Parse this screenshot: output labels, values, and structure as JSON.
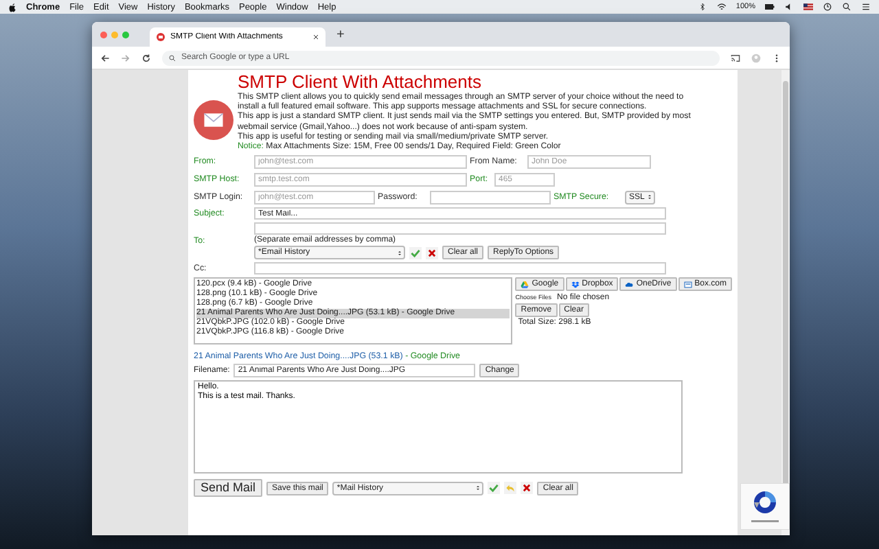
{
  "menubar": {
    "app": "Chrome",
    "menus": [
      "File",
      "Edit",
      "View",
      "History",
      "Bookmarks",
      "People",
      "Window",
      "Help"
    ],
    "battery": "100%"
  },
  "browser": {
    "tab_title": "SMTP Client With Attachments",
    "new_tab": "+",
    "omnibox_placeholder": "Search Google or type a URL"
  },
  "page": {
    "title": "SMTP Client With Attachments",
    "description": [
      "This SMTP client allows you to quickly send email messages through an SMTP server of your choice without the need to install a full featured email software. This app supports message attachments and SSL for secure connections.",
      "This app is just a standard SMTP client. It just sends mail via the SMTP settings you entered. But, SMTP provided by most webmail service (Gmail,Yahoo...) does not work because of anti-spam system.",
      "This app is useful for testing or sending mail via small/medium/private SMTP server."
    ],
    "notice_label": "Notice:",
    "notice": "Max Attachments Size: 15M, Free 00 sends/1 Day, Required Field: Green Color"
  },
  "settings": [
    [
      {
        "label": "From:",
        "required": true,
        "kind": "input",
        "placeholder": "john@test.com"
      },
      {
        "label": "From Name:",
        "required": false,
        "kind": "input",
        "placeholder": "John Doe"
      }
    ],
    [
      {
        "label": "SMTP Host:",
        "required": true,
        "kind": "input",
        "placeholder": "smtp.test.com"
      },
      {
        "label": "Port:",
        "required": true,
        "kind": "input",
        "placeholder": "465"
      }
    ],
    [
      {
        "label": "SMTP Login:",
        "required": false,
        "kind": "input",
        "placeholder": "john@test.com"
      },
      {
        "label": "Password:",
        "required": false,
        "kind": "input"
      },
      {
        "label": "SMTP Secure:",
        "required": true,
        "kind": "select",
        "value": "SSL"
      }
    ]
  ],
  "subject": {
    "label": "Subject:",
    "required": true,
    "value": "Test Mail..."
  },
  "to": {
    "label": "To:",
    "required": true,
    "hint": "(Separate email addresses by comma)",
    "history": "*Email History",
    "clear": "Clear all",
    "replyto": "ReplyTo Options"
  },
  "cc": {
    "label": "Cc:",
    "required": false
  },
  "attachments": {
    "files": [
      {
        "name": "120.pcx (9.4 kB) - Google Drive",
        "selected": false
      },
      {
        "name": "128.png (10.1 kB) - Google Drive",
        "selected": false
      },
      {
        "name": "128.png (6.7 kB) - Google Drive",
        "selected": false
      },
      {
        "name": "21 Animal Parents Who Are Just Doing....JPG (53.1 kB) - Google Drive",
        "selected": true
      },
      {
        "name": "21VQbkP.JPG (102.0 kB) - Google Drive",
        "selected": false
      },
      {
        "name": "21VQbkP.JPG (116.8 kB) - Google Drive",
        "selected": false
      }
    ],
    "sources": [
      {
        "label": "Google",
        "kind": "google"
      },
      {
        "label": "Dropbox",
        "kind": "dropbox"
      },
      {
        "label": "OneDrive",
        "kind": "onedrive"
      },
      {
        "label": "Box.com",
        "kind": "box"
      }
    ],
    "choose": "Choose Files",
    "no_file": "No file chosen",
    "remove": "Remove",
    "clear": "Clear",
    "total": "Total Size: 298.1 kB",
    "current": {
      "name": "21 Animal Parents Who Are Just Doing....JPG (53.1 kB)",
      "source": "- Google Drive"
    },
    "filename_label": "Filename:",
    "filename": "21 Animal Parents Who Are Just Doing....JPG",
    "change": "Change"
  },
  "message": "Hello.\nThis is a test mail. Thanks.",
  "footer": {
    "send": "Send Mail",
    "save": "Save this mail",
    "history": "*Mail History",
    "clear": "Clear all"
  }
}
